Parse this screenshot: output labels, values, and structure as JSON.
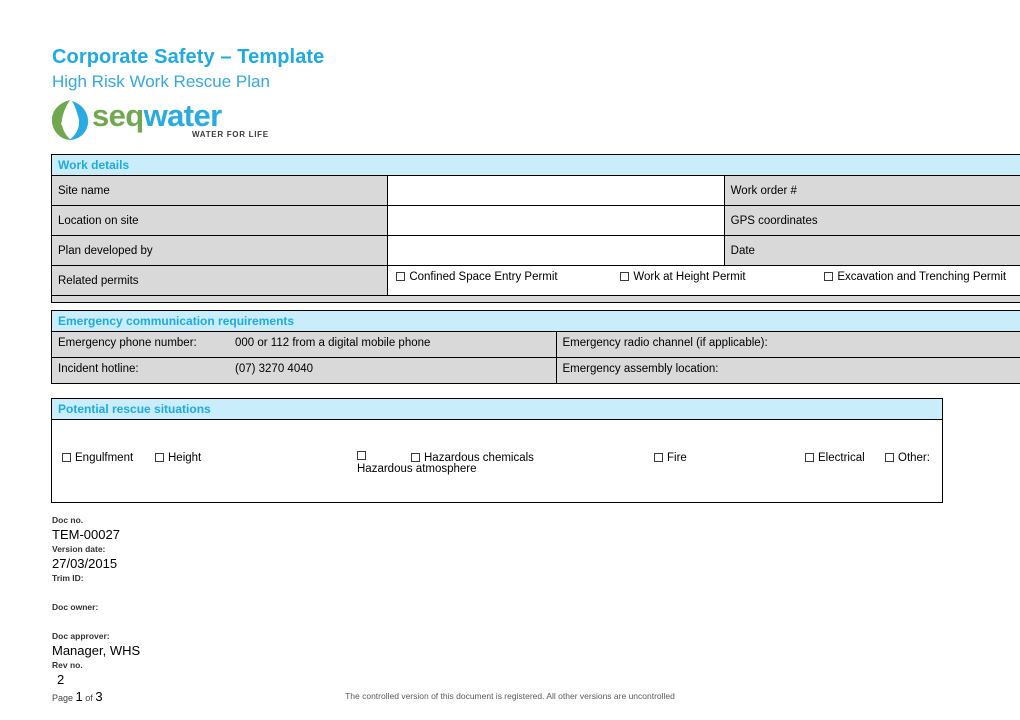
{
  "header": {
    "title": "Corporate Safety – Template",
    "subtitle": "High Risk Work Rescue Plan"
  },
  "logo": {
    "word_first": "seq",
    "word_second": "water",
    "tagline": "WATER FOR LIFE",
    "icon": "water-swirl-icon",
    "color_green": "#6fa84f",
    "color_blue": "#29abe2"
  },
  "colors": {
    "accent_blue": "#1fabe2",
    "section_header_bg": "#c9edfb",
    "label_bg": "#d9d9d9",
    "border": "#000000"
  },
  "sections": {
    "work_details": {
      "heading": "Work details",
      "rows": [
        {
          "label": "Site name",
          "value": "",
          "right_label": "Work order #",
          "right_value": ""
        },
        {
          "label": "Location on site",
          "value": "",
          "right_label": "GPS coordinates",
          "right_value": ""
        },
        {
          "label": "Plan developed by",
          "value": "",
          "right_label": "Date",
          "right_value": ""
        }
      ],
      "permits_label": "Related permits",
      "permits": [
        {
          "label": "Confined Space Entry Permit",
          "checked": false
        },
        {
          "label": "Work at Height Permit",
          "checked": false
        },
        {
          "label": "Excavation and Trenching Permit",
          "checked": false
        }
      ]
    },
    "emergency_communication": {
      "heading": "Emergency communication requirements",
      "rows": [
        {
          "left_label": "Emergency phone number:",
          "left_value": "000 or 112 from a digital mobile phone",
          "right_label": "Emergency radio channel (if applicable):",
          "right_value": ""
        },
        {
          "left_label": "Incident hotline:",
          "left_value": "(07) 3270 4040",
          "right_label": "Emergency assembly location:",
          "right_value": ""
        }
      ]
    },
    "potential_rescue_situations": {
      "heading": "Potential rescue situations",
      "options": [
        {
          "label": "Engulfment",
          "checked": false
        },
        {
          "label": "Height",
          "checked": false
        },
        {
          "label": "Hazardous atmosphere",
          "checked": false
        },
        {
          "label": "Hazardous chemicals",
          "checked": false
        },
        {
          "label": "Fire",
          "checked": false
        },
        {
          "label": "Electrical",
          "checked": false
        },
        {
          "label": "Other:",
          "checked": false
        }
      ]
    }
  },
  "footer": {
    "doc_no_label": "Doc no.",
    "doc_no": "TEM-00027",
    "version_date_label": "Version date:",
    "version_date": "27/03/2015",
    "trim_id_label": "Trim ID:",
    "trim_id": "",
    "doc_owner_label": "Doc owner:",
    "doc_owner": "",
    "doc_approver_label": "Doc approver:",
    "doc_approver": "Manager, WHS",
    "rev_no_label": "Rev no.",
    "rev_no": "2",
    "page_word": "Page",
    "page_current": "1",
    "page_of": "of",
    "page_total": "3",
    "disclaimer": "The controlled version of this document is registered. All other versions are uncontrolled"
  }
}
